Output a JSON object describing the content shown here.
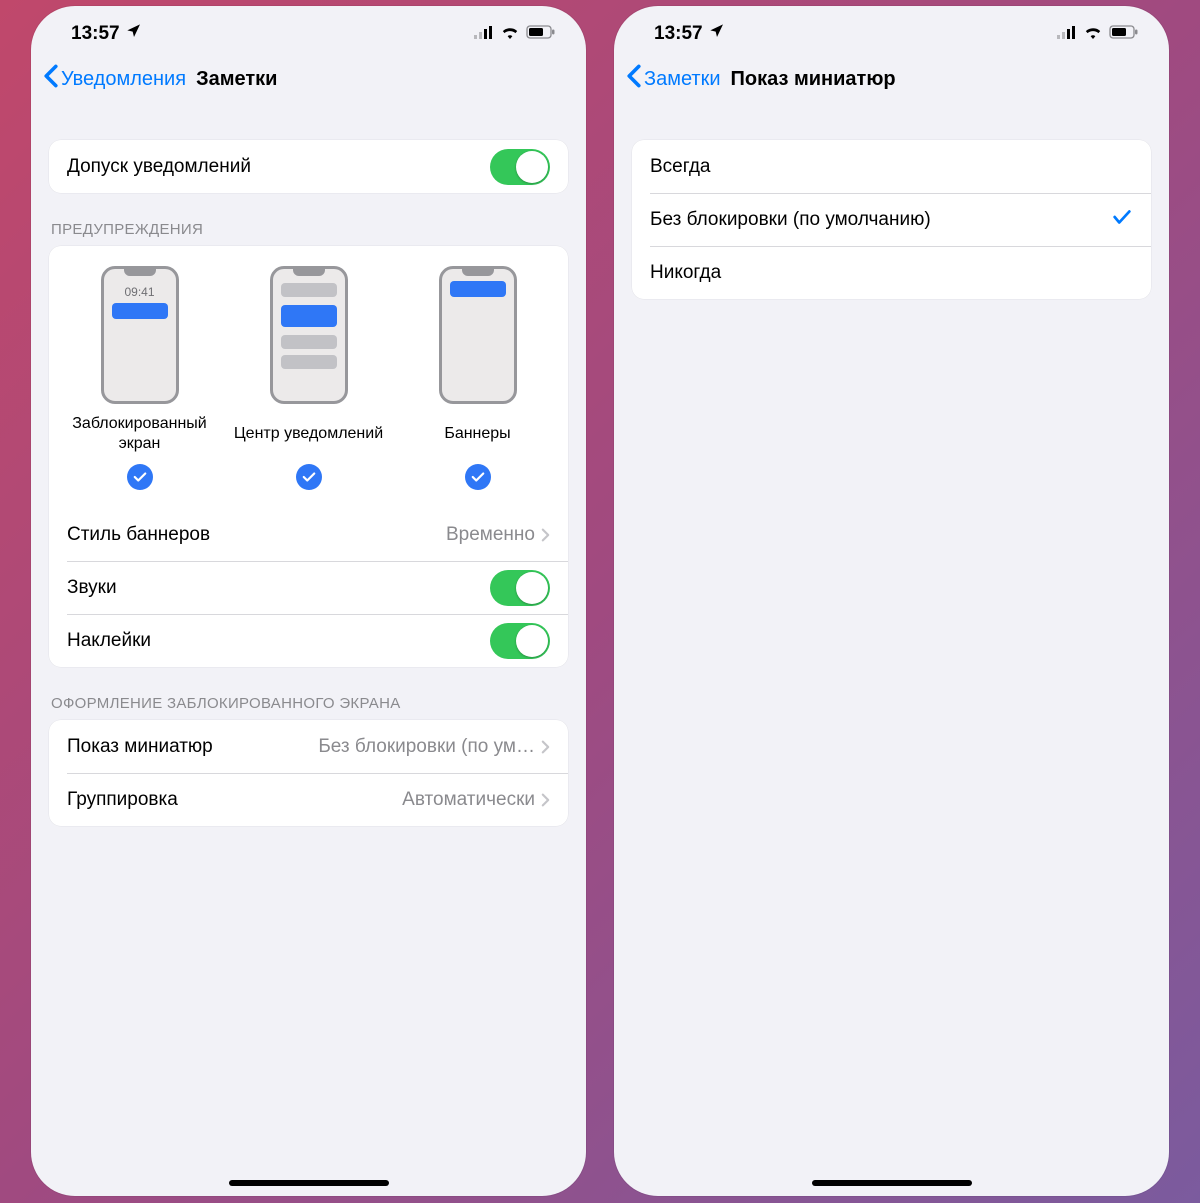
{
  "status": {
    "time": "13:57"
  },
  "left": {
    "back_label": "Уведомления",
    "title": "Заметки",
    "allow": {
      "label": "Допуск уведомлений",
      "on": true
    },
    "alerts_header": "ПРЕДУПРЕЖДЕНИЯ",
    "alerts": {
      "lock": {
        "label": "Заблокированный экран",
        "time": "09:41"
      },
      "center": {
        "label": "Центр уведомлений"
      },
      "banner": {
        "label": "Баннеры"
      }
    },
    "banner_style": {
      "label": "Стиль баннеров",
      "value": "Временно"
    },
    "sounds": {
      "label": "Звуки",
      "on": true
    },
    "badges": {
      "label": "Наклейки",
      "on": true
    },
    "lockscreen_header": "ОФОРМЛЕНИЕ ЗАБЛОКИРОВАННОГО ЭКРАНА",
    "previews": {
      "label": "Показ миниатюр",
      "value": "Без блокировки (по ум…"
    },
    "grouping": {
      "label": "Группировка",
      "value": "Автоматически"
    }
  },
  "right": {
    "back_label": "Заметки",
    "title": "Показ миниатюр",
    "options": [
      {
        "label": "Всегда",
        "selected": false
      },
      {
        "label": "Без блокировки (по умолчанию)",
        "selected": true
      },
      {
        "label": "Никогда",
        "selected": false
      }
    ]
  }
}
